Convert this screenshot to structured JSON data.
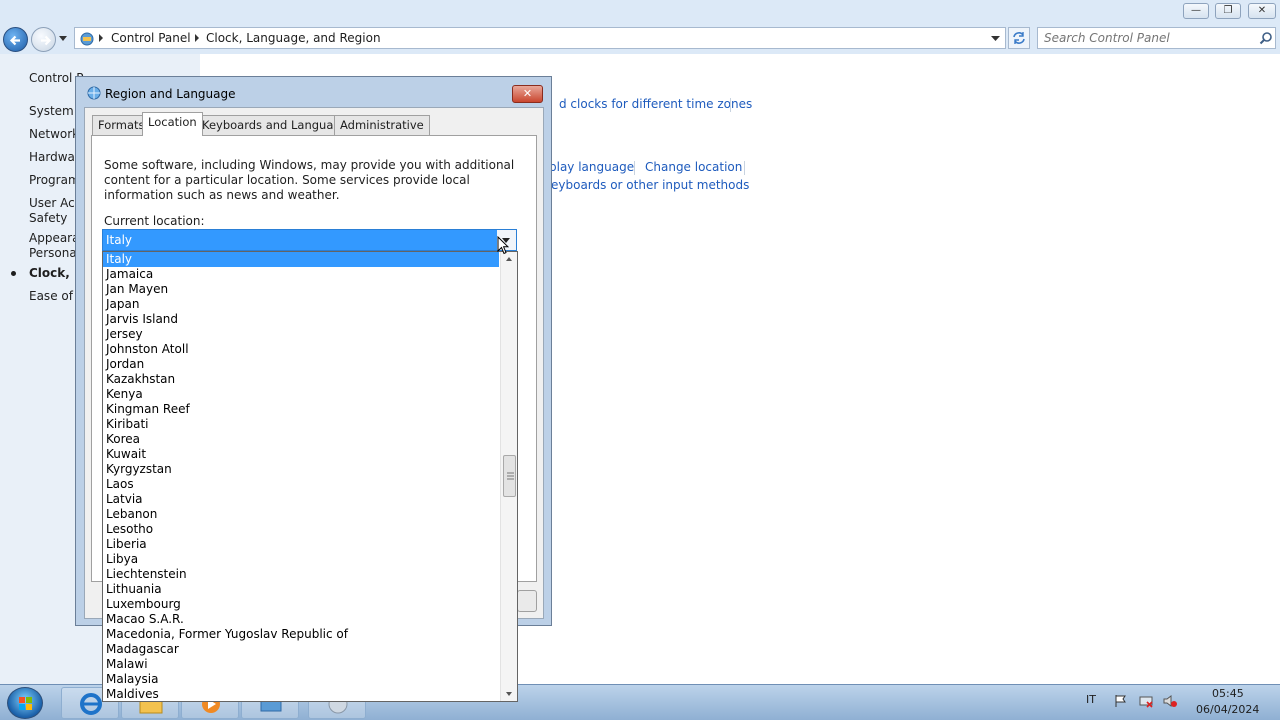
{
  "window": {
    "minimize_glyph": "—",
    "maximize_glyph": "❐",
    "close_glyph": "✕"
  },
  "address": {
    "crumbs": [
      "Control Panel",
      "Clock, Language, and Region"
    ]
  },
  "search": {
    "placeholder": "Search Control Panel"
  },
  "leftnav": {
    "items": [
      {
        "label": "Control P"
      },
      {
        "label": "System a"
      },
      {
        "label": "Network"
      },
      {
        "label": "Hardwar"
      },
      {
        "label": "Program"
      },
      {
        "label": "User Acc"
      },
      {
        "label": "Safety"
      },
      {
        "label": "Appeara"
      },
      {
        "label": "Personal"
      },
      {
        "label": "Clock, La"
      },
      {
        "label": "Ease of A"
      }
    ],
    "active_index": 9
  },
  "main": {
    "links": [
      {
        "label": "d clocks for different time zones"
      },
      {
        "label": "play language"
      },
      {
        "label": "Change location"
      },
      {
        "label": "eyboards or other input methods"
      }
    ]
  },
  "dialog": {
    "title": "Region and Language",
    "close_glyph": "✕",
    "tabs": [
      {
        "label": "Formats"
      },
      {
        "label": "Location"
      },
      {
        "label": "Keyboards and Languages"
      },
      {
        "label": "Administrative"
      }
    ],
    "active_tab": 1,
    "description": "Some software, including Windows, may provide you with additional content for a particular location. Some services provide local information such as news and weather.",
    "location_label": "Current location:",
    "location_value": "Italy",
    "options": [
      "Italy",
      "Jamaica",
      "Jan Mayen",
      "Japan",
      "Jarvis Island",
      "Jersey",
      "Johnston Atoll",
      "Jordan",
      "Kazakhstan",
      "Kenya",
      "Kingman Reef",
      "Kiribati",
      "Korea",
      "Kuwait",
      "Kyrgyzstan",
      "Laos",
      "Latvia",
      "Lebanon",
      "Lesotho",
      "Liberia",
      "Libya",
      "Liechtenstein",
      "Lithuania",
      "Luxembourg",
      "Macao S.A.R.",
      "Macedonia, Former Yugoslav Republic of",
      "Madagascar",
      "Malawi",
      "Malaysia",
      "Maldives"
    ],
    "selected_option": "Italy"
  },
  "taskbar": {
    "language": "IT",
    "time": "05:45",
    "date": "06/04/2024"
  }
}
